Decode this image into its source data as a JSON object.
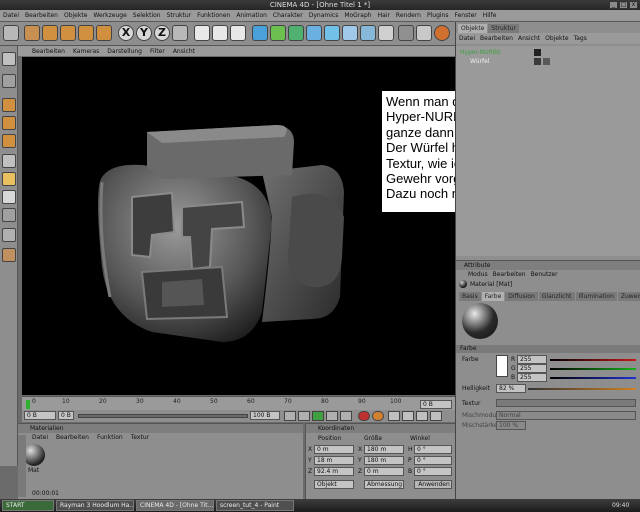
{
  "window": {
    "title": "CINEMA 4D - [Ohne Titel 1 *]",
    "min": "_",
    "max": "□",
    "close": "x"
  },
  "menu": [
    "Datei",
    "Bearbeiten",
    "Objekte",
    "Werkzeuge",
    "Selektion",
    "Struktur",
    "Funktionen",
    "Animation",
    "Charakter",
    "Dynamics",
    "MoGraph",
    "Hair",
    "Rendern",
    "Plugins",
    "Fenster",
    "Hilfe"
  ],
  "toolbar": {
    "axis_x": "X",
    "axis_y": "Y",
    "axis_z": "Z"
  },
  "viewport": {
    "menu": [
      "Bearbeiten",
      "Kameras",
      "Darstellung",
      "Filter",
      "Ansicht"
    ]
  },
  "note": {
    "lines": [
      "Wenn man den Würfel noch in ein",
      "Hyper-NURBS steckt, soeht das",
      "ganze dann so aus.",
      "Der Würfel hat auch jetzt eine",
      "Textur, wie ich sie für dein",
      "Gewehr vorgeschlagen hätte.",
      "Dazu noch ne Relief-Map..."
    ]
  },
  "timeline": {
    "ticks": [
      "0",
      "10",
      "20",
      "30",
      "40",
      "50",
      "60",
      "70",
      "80",
      "90",
      "100"
    ],
    "start": "0 B",
    "current": "0 B",
    "end": "100 B",
    "frame_right": "0 B"
  },
  "materials": {
    "header": "Materialien",
    "menu": [
      "Datei",
      "Bearbeiten",
      "Funktion",
      "Textur"
    ],
    "item_name": "Mat",
    "frame": "00:00:01"
  },
  "coords": {
    "header": "Koordinaten",
    "col_position": "Position",
    "col_size": "Größe",
    "col_angle": "Winkel",
    "rows": [
      {
        "axis": "X",
        "pos": "0 m",
        "size": "180 m",
        "angle_axis": "H",
        "angle": "0 °"
      },
      {
        "axis": "Y",
        "pos": "18 m",
        "size": "180 m",
        "angle_axis": "P",
        "angle": "0 °"
      },
      {
        "axis": "Z",
        "pos": "92.4 m",
        "size": "0 m",
        "angle_axis": "B",
        "angle": "0 °"
      }
    ],
    "mode": "Objekt",
    "size_mode": "Abmessung",
    "apply": "Anwenden"
  },
  "objects": {
    "tabs": [
      "Objekte",
      "Struktur"
    ],
    "menu": [
      "Datei",
      "Bearbeiten",
      "Ansicht",
      "Objekte",
      "Tags"
    ],
    "items": [
      "Hyper-NURBS",
      "Würfel"
    ]
  },
  "attributes": {
    "header": "Attribute",
    "menu": [
      "Modus",
      "Bearbeiten",
      "Benutzer"
    ],
    "material_name": "Material [Mat]",
    "tabs": [
      "Basis",
      "Farbe",
      "Diffusion",
      "Glanzlicht",
      "Illumination",
      "Zuweisen"
    ],
    "section": "Farbe",
    "color_label": "Farbe",
    "r_label": "R",
    "r_value": "255",
    "g_label": "G",
    "g_value": "255",
    "b_label": "B",
    "b_value": "255",
    "brightness_label": "Helligkeit",
    "brightness_value": "82 %",
    "texture_label": "Textur",
    "mix_mode_label": "Mischmodus",
    "mix_mode_value": "Normal",
    "mix_strength_label": "Mischstärke",
    "mix_strength_value": "100 %"
  },
  "taskbar": {
    "start": "START",
    "tasks": [
      "Rayman 3 Hoodlum Ha...",
      "CINEMA 4D - [Ohne Tit...",
      "screen_tut_4 - Paint"
    ],
    "clock": "09:40"
  },
  "colors": {
    "red": "#c81818",
    "green": "#18b018",
    "blue": "#2030d0",
    "accent_orange": "#d08020"
  }
}
